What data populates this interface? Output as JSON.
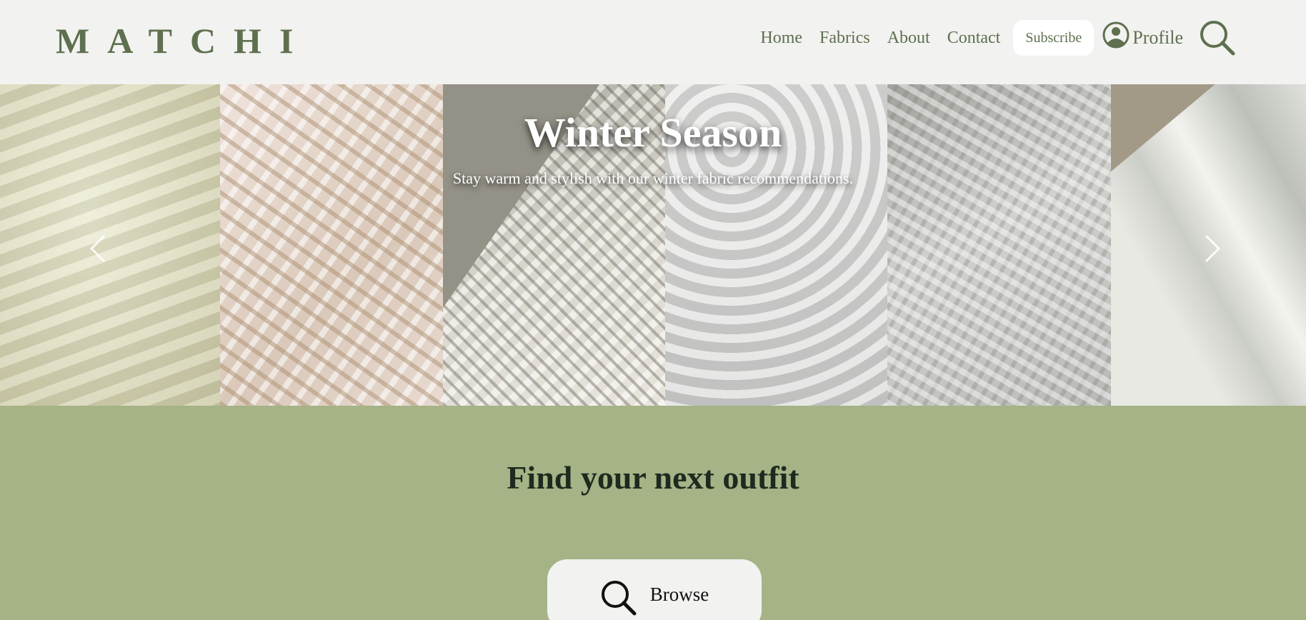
{
  "header": {
    "logo": "MATCHI",
    "nav": [
      "Home",
      "Fabrics",
      "About",
      "Contact"
    ],
    "subscribe_label": "Subscribe",
    "profile_label": "Profile",
    "search_icon": "search-icon",
    "profile_icon": "user-circle-icon"
  },
  "hero": {
    "title": "Winter Season",
    "subtitle": "Stay warm and stylish with our winter fabric recommendations.",
    "prev_icon": "chevron-left-icon",
    "next_icon": "chevron-right-icon"
  },
  "section": {
    "title": "Find your next outfit",
    "browse_label": "Browse",
    "browse_icon": "search-icon"
  },
  "colors": {
    "header_bg": "#f2f2f0",
    "brand": "#5e704f",
    "section_bg": "#a5b386"
  }
}
